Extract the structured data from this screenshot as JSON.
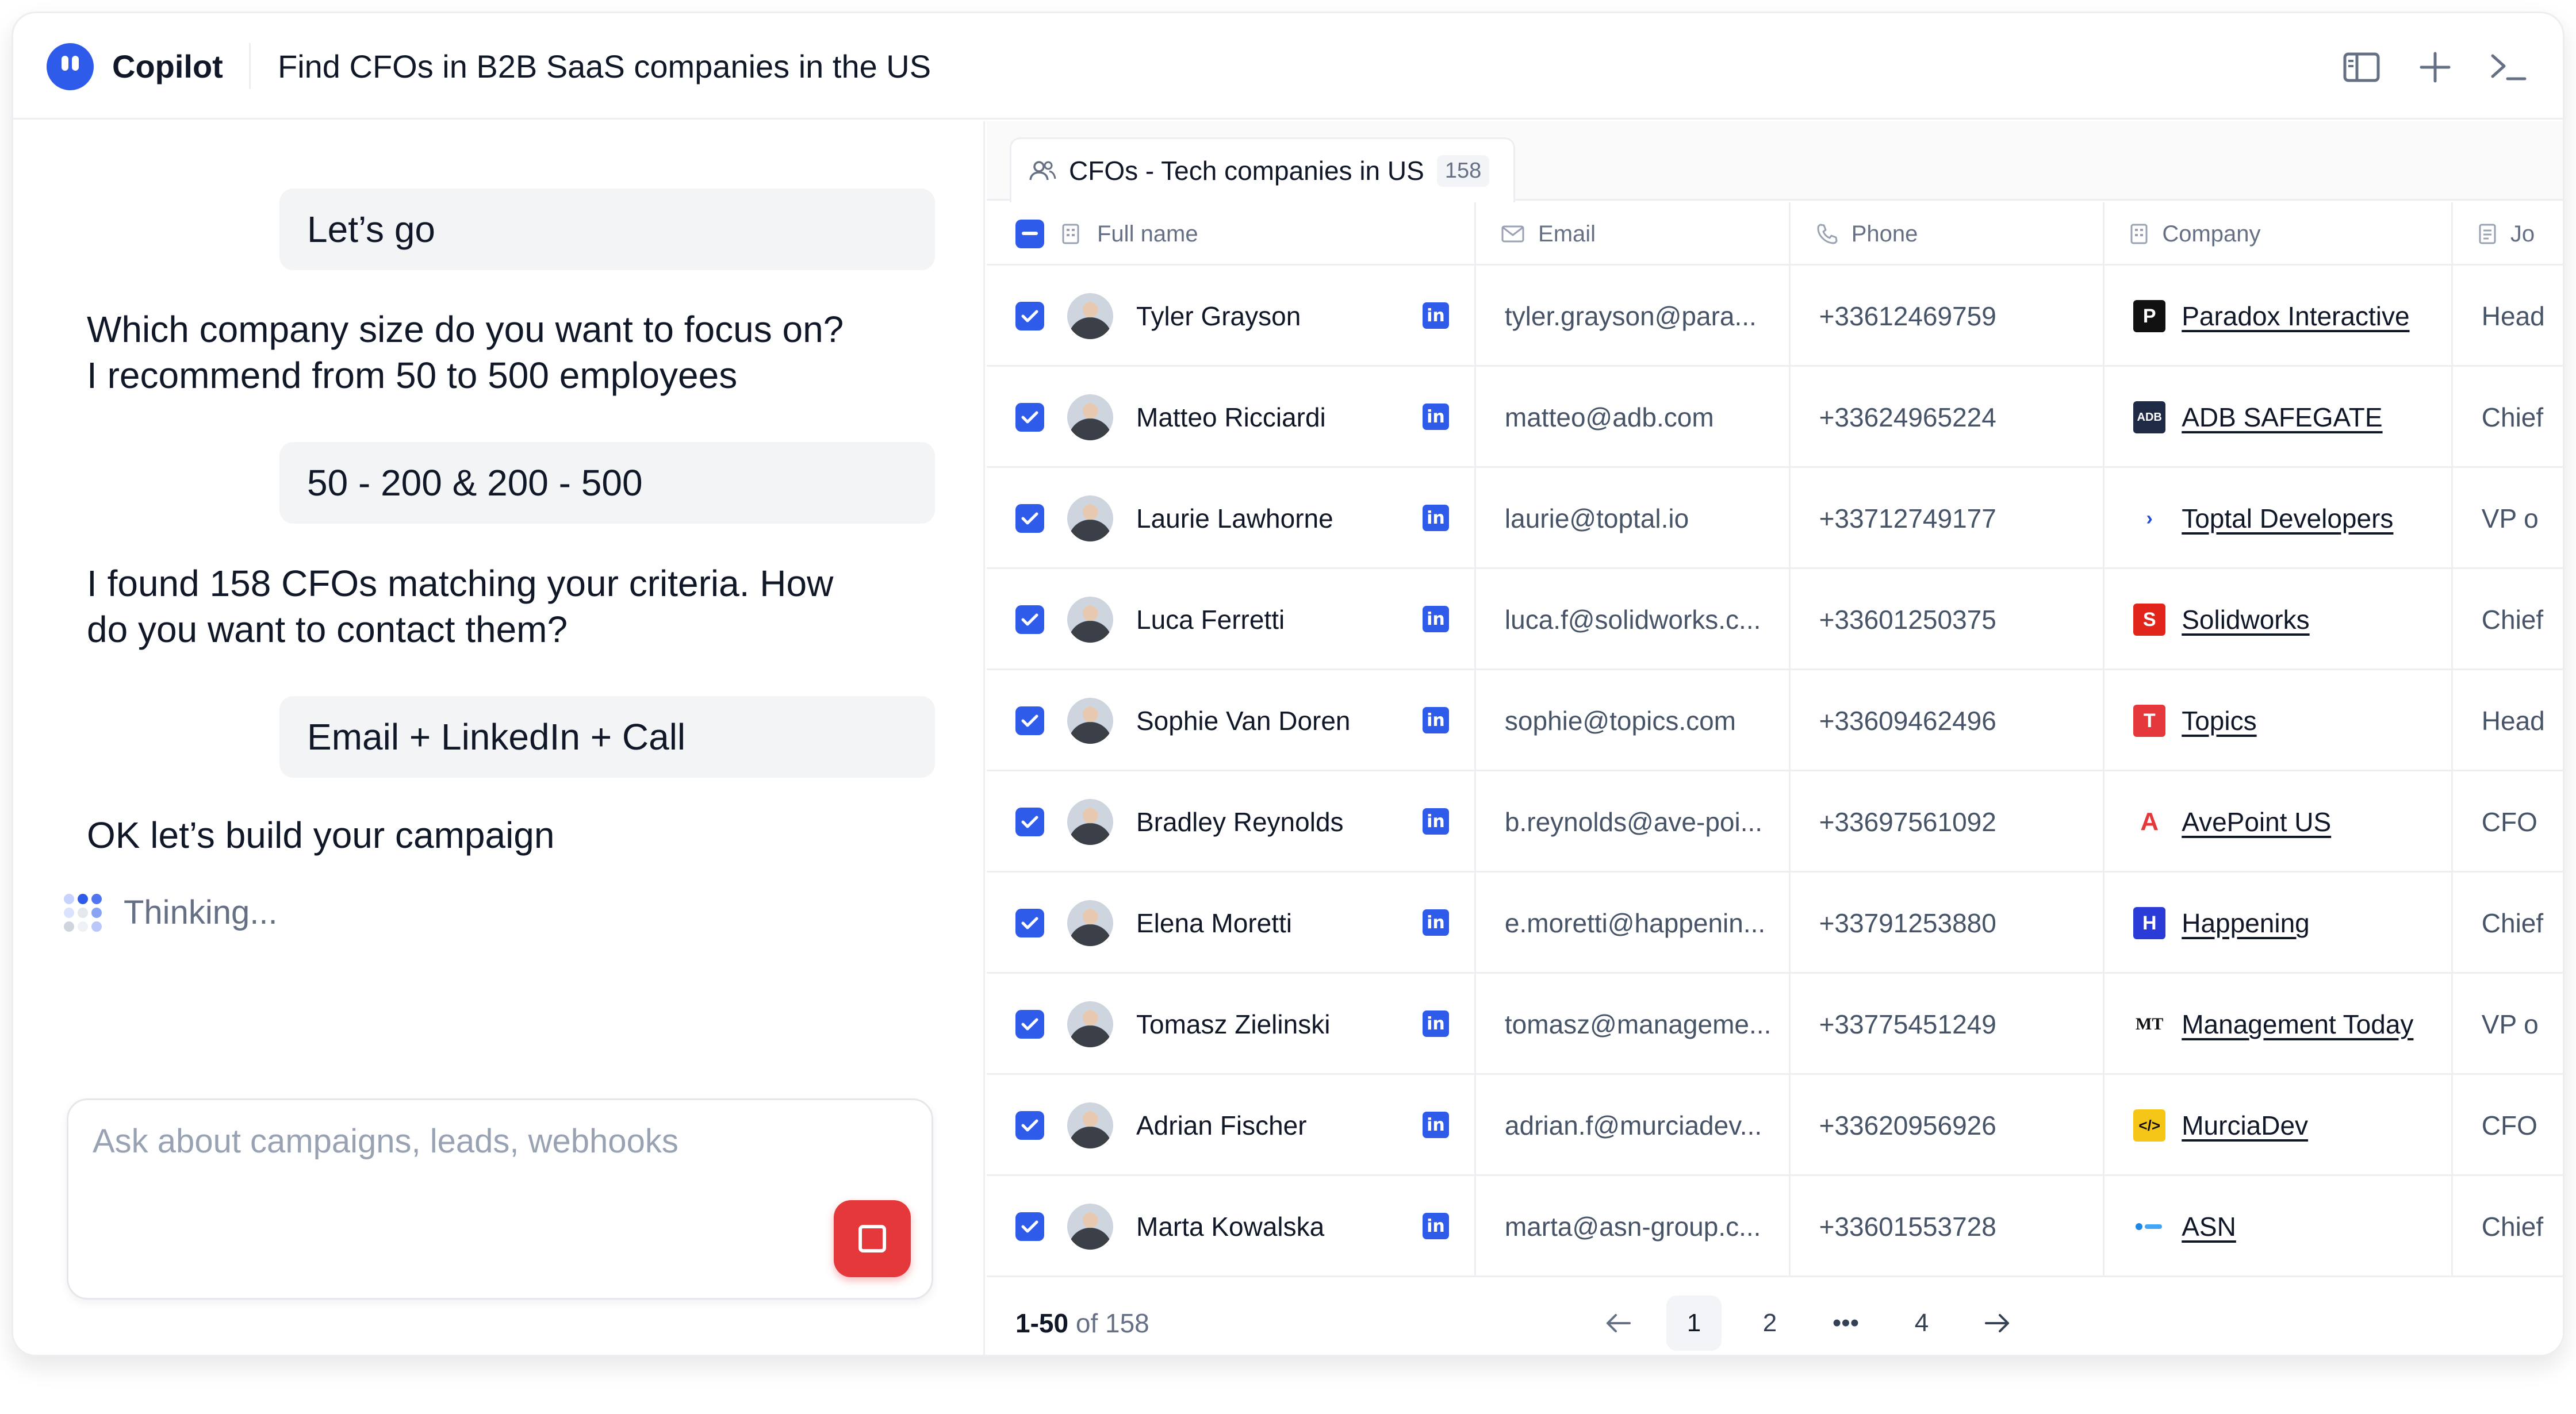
{
  "header": {
    "brand": "Copilot",
    "title": "Find CFOs in B2B SaaS companies in the US",
    "icons": [
      "sidebar-toggle-icon",
      "plus-icon",
      "terminal-icon"
    ]
  },
  "chat": {
    "messages": [
      {
        "role": "user",
        "text": "Let’s go"
      },
      {
        "role": "assistant",
        "line1": "Which company size do you want to focus on?",
        "line2": "I recommend from 50 to 500 employees"
      },
      {
        "role": "user",
        "text": "50 - 200 & 200 - 500"
      },
      {
        "role": "assistant",
        "line1": "I found 158 CFOs matching your criteria. How",
        "line2": "do you want to contact them?"
      },
      {
        "role": "user",
        "text": "Email + LinkedIn + Call"
      },
      {
        "role": "assistant",
        "line1": "OK let’s build your campaign",
        "line2": ""
      }
    ],
    "thinking": "Thinking...",
    "input_placeholder": "Ask about campaigns, leads, webhooks"
  },
  "table": {
    "tab_label": "CFOs - Tech companies in US",
    "tab_count": "158",
    "columns": {
      "name": "Full name",
      "email": "Email",
      "phone": "Phone",
      "company": "Company",
      "job": "Jo"
    },
    "rows": [
      {
        "name": "Tyler Grayson",
        "email": "tyler.grayson@para...",
        "phone": "+33612469759",
        "company": "Paradox Interactive",
        "job": "Head"
      },
      {
        "name": "Matteo Ricciardi",
        "email": "matteo@adb.com",
        "phone": "+33624965224",
        "company": "ADB SAFEGATE",
        "job": "Chief"
      },
      {
        "name": "Laurie Lawhorne",
        "email": "laurie@toptal.io",
        "phone": "+33712749177",
        "company": "Toptal Developers",
        "job": "VP o"
      },
      {
        "name": "Luca Ferretti",
        "email": "luca.f@solidworks.c...",
        "phone": "+33601250375",
        "company": "Solidworks",
        "job": "Chief"
      },
      {
        "name": "Sophie Van Doren",
        "email": "sophie@topics.com",
        "phone": "+33609462496",
        "company": "Topics",
        "job": "Head"
      },
      {
        "name": "Bradley Reynolds",
        "email": "b.reynolds@ave-poi...",
        "phone": "+33697561092",
        "company": "AvePoint US",
        "job": "CFO"
      },
      {
        "name": "Elena Moretti",
        "email": "e.moretti@happenin...",
        "phone": "+33791253880",
        "company": "Happening",
        "job": "Chief"
      },
      {
        "name": "Tomasz Zielinski",
        "email": "tomasz@manageme...",
        "phone": "+33775451249",
        "company": "Management Today",
        "job": "VP o"
      },
      {
        "name": "Adrian Fischer",
        "email": "adrian.f@murciadev...",
        "phone": "+33620956926",
        "company": "MurciaDev",
        "job": "CFO"
      },
      {
        "name": "Marta Kowalska",
        "email": "marta@asn-group.c...",
        "phone": "+33601553728",
        "company": "ASN",
        "job": "Chief"
      }
    ],
    "pagination": {
      "range": "1-50",
      "of_text": "of 158",
      "pages": [
        "1",
        "2",
        "•••",
        "4"
      ],
      "active": "1"
    }
  },
  "colors": {
    "accent": "#2e5bea",
    "stop": "#e5383b"
  }
}
